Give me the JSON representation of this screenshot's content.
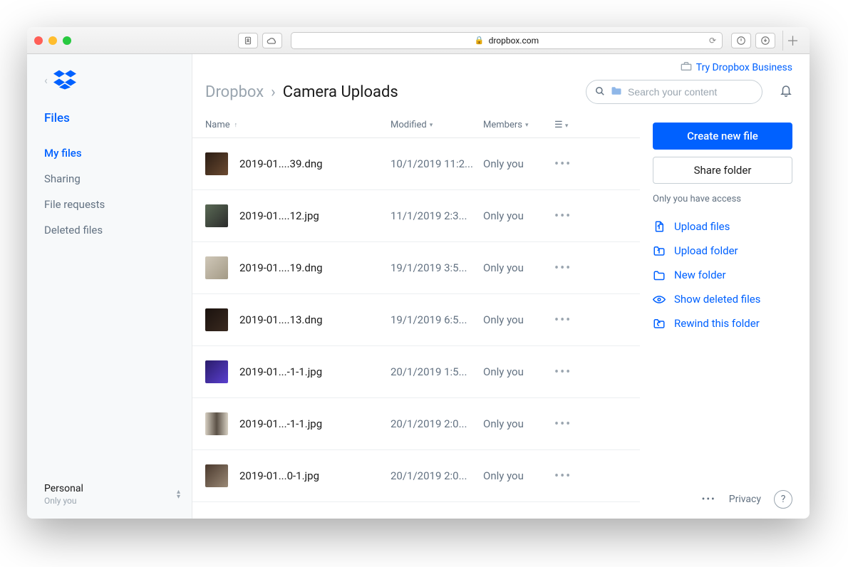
{
  "browser": {
    "domain": "dropbox.com"
  },
  "topbar": {
    "try_business": "Try Dropbox Business"
  },
  "breadcrumb": {
    "root": "Dropbox",
    "current": "Camera Uploads"
  },
  "search": {
    "placeholder": "Search your content"
  },
  "sidebar": {
    "head": "Files",
    "items": [
      {
        "label": "My files",
        "active": true
      },
      {
        "label": "Sharing"
      },
      {
        "label": "File requests"
      },
      {
        "label": "Deleted files"
      }
    ],
    "footer": {
      "account": "Personal",
      "access": "Only you"
    }
  },
  "columns": {
    "name": "Name",
    "modified": "Modified",
    "members": "Members"
  },
  "files": [
    {
      "name": "2019-01....39.dng",
      "modified": "10/1/2019 11:2...",
      "members": "Only you",
      "thumb": "linear-gradient(135deg,#2b1d14,#6b4a31)"
    },
    {
      "name": "2019-01....12.jpg",
      "modified": "11/1/2019 2:3...",
      "members": "Only you",
      "thumb": "linear-gradient(135deg,#5a6a55,#2b2b2b)"
    },
    {
      "name": "2019-01....19.dng",
      "modified": "19/1/2019 3:5...",
      "members": "Only you",
      "thumb": "linear-gradient(135deg,#cfc7b8,#a39a86)"
    },
    {
      "name": "2019-01....13.dng",
      "modified": "19/1/2019 6:5...",
      "members": "Only you",
      "thumb": "linear-gradient(135deg,#1a120e,#3a2a20)"
    },
    {
      "name": "2019-01...-1-1.jpg",
      "modified": "20/1/2019 1:5...",
      "members": "Only you",
      "thumb": "linear-gradient(135deg,#2a1c6b,#5a3fcf)"
    },
    {
      "name": "2019-01...-1-1.jpg",
      "modified": "20/1/2019 2:0...",
      "members": "Only you",
      "thumb": "linear-gradient(90deg,#d6cfc2,#5b5146,#d6cfc2)"
    },
    {
      "name": "2019-01...0-1.jpg",
      "modified": "20/1/2019 2:0...",
      "members": "Only you",
      "thumb": "linear-gradient(135deg,#4a392d,#9a8976)"
    }
  ],
  "actions": {
    "create": "Create new file",
    "share": "Share folder",
    "access_note": "Only you have access",
    "links": [
      {
        "icon": "upload-file-icon",
        "label": "Upload files"
      },
      {
        "icon": "upload-folder-icon",
        "label": "Upload folder"
      },
      {
        "icon": "new-folder-icon",
        "label": "New folder"
      },
      {
        "icon": "eye-icon",
        "label": "Show deleted files"
      },
      {
        "icon": "rewind-icon",
        "label": "Rewind this folder"
      }
    ]
  },
  "footer": {
    "privacy": "Privacy"
  }
}
